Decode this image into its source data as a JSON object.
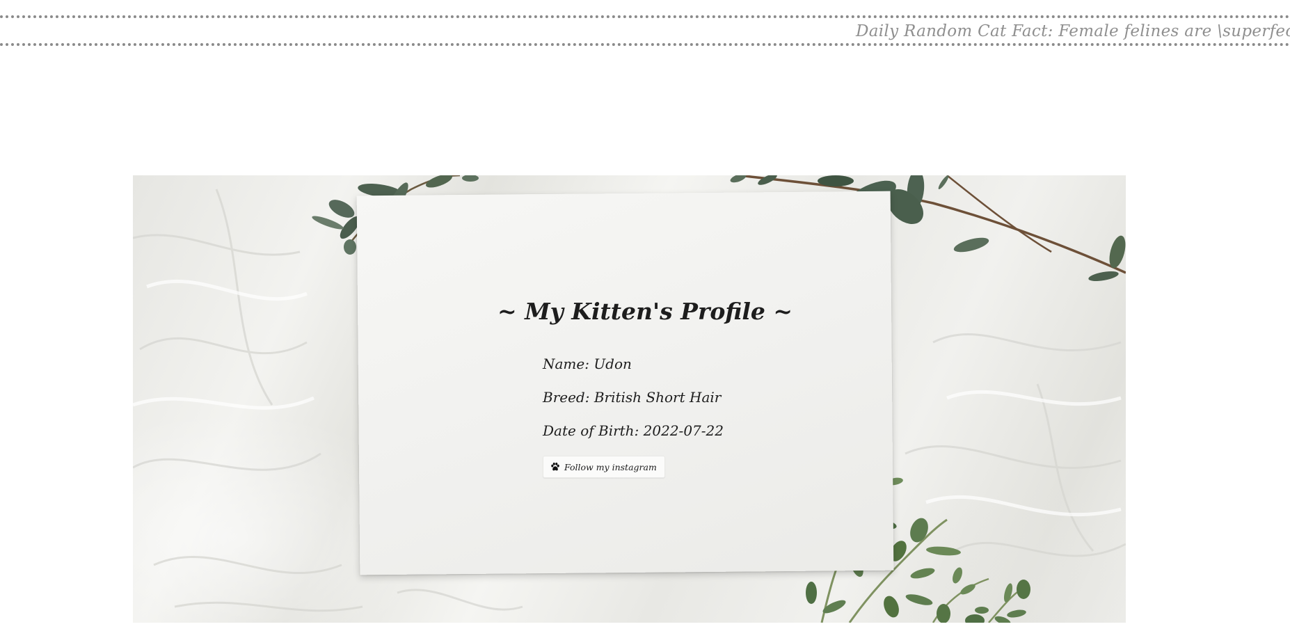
{
  "cat_fact": {
    "text": "Daily Random Cat Fact: Female felines are \\superfecun"
  },
  "profile": {
    "title": "~ My Kitten's Profile ~",
    "name_line": "Name: Udon",
    "breed_line": "Breed: British Short Hair",
    "dob_line": "Date of Birth: 2022-07-22"
  },
  "instagram_button": {
    "label": "Follow my instagram",
    "icon": "paw-icon"
  },
  "colors": {
    "marquee_text": "#8f8f8f",
    "card": "#f4f4f2",
    "leaf": "#4a5e4c"
  }
}
